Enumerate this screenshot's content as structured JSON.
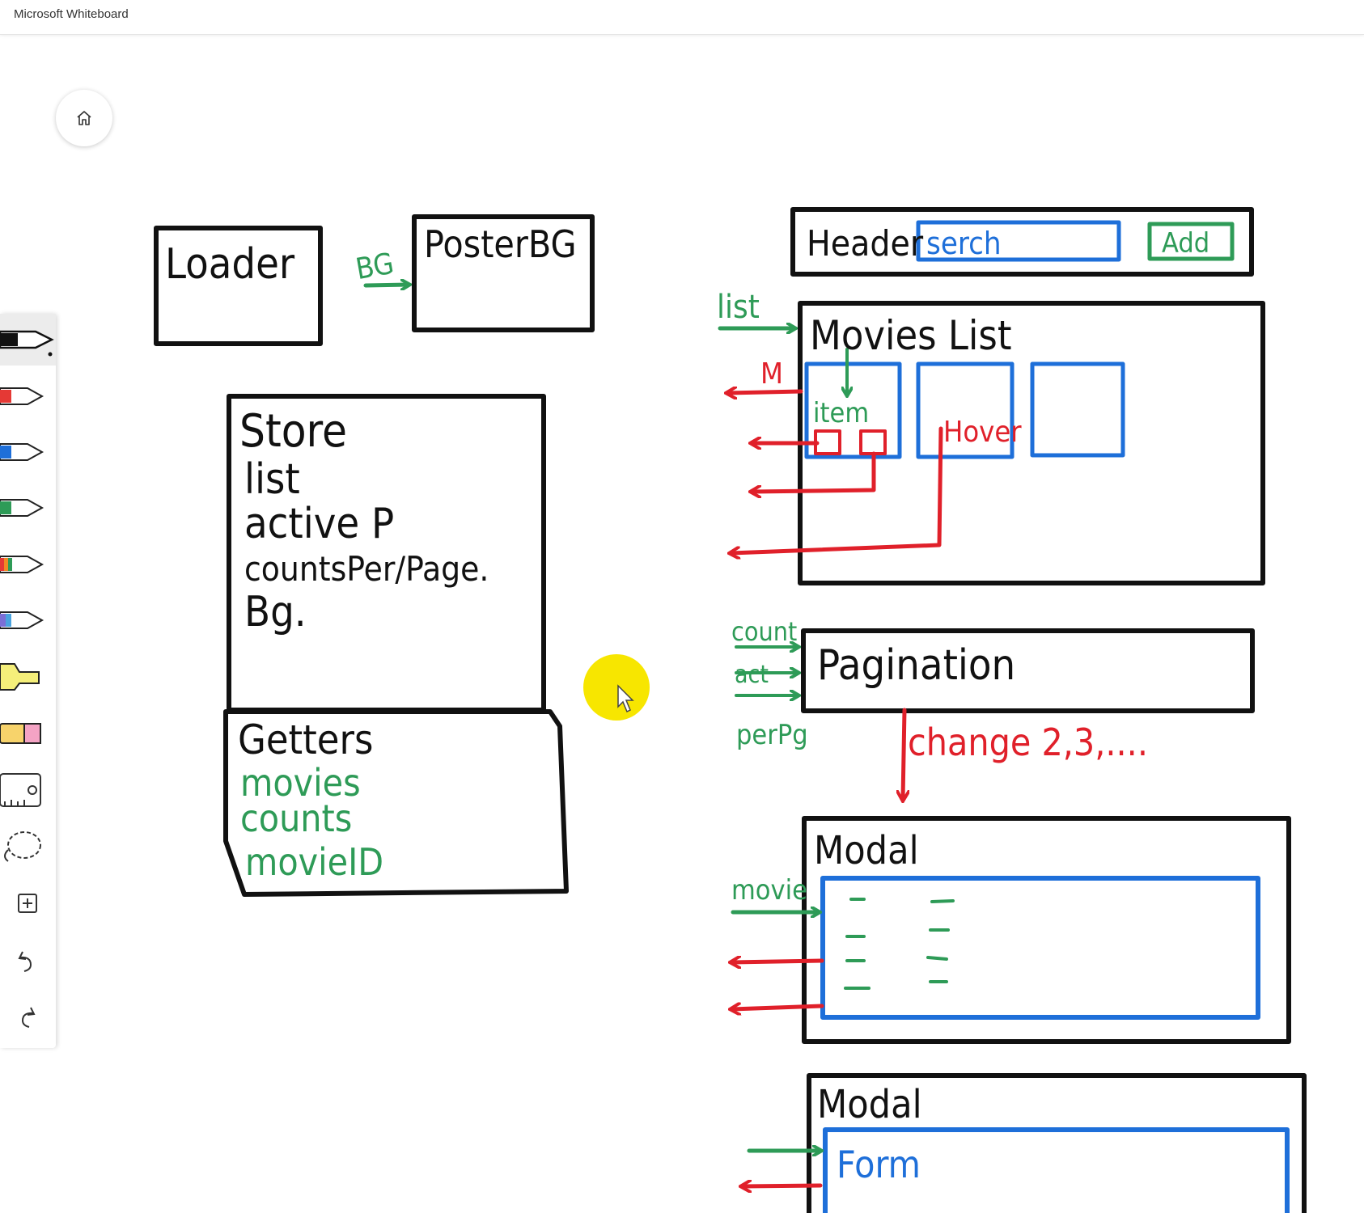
{
  "app": {
    "title": "Microsoft Whiteboard"
  },
  "toolbar": {
    "tools": [
      {
        "name": "pen-black",
        "color": "#111111",
        "selected": true
      },
      {
        "name": "pen-red",
        "color": "#e53935"
      },
      {
        "name": "pen-blue",
        "color": "#1e6fd9"
      },
      {
        "name": "pen-green",
        "color": "#2e9b57"
      },
      {
        "name": "pen-rainbow",
        "color": "#f08a24"
      },
      {
        "name": "pen-galaxy",
        "color": "#7b6fd6"
      },
      {
        "name": "highlighter",
        "color": "#f5ef7a"
      },
      {
        "name": "eraser",
        "color": "#f4a3c4"
      },
      {
        "name": "ruler-icon"
      },
      {
        "name": "lasso-icon"
      },
      {
        "name": "add-icon"
      },
      {
        "name": "undo-icon"
      },
      {
        "name": "redo-icon"
      }
    ]
  },
  "board": {
    "loader": "Loader",
    "bg_arrow": "BG",
    "poster": "PosterBG",
    "store": {
      "title": "Store",
      "lines": [
        "list",
        "active P",
        "countsPer/Page.",
        "Bg."
      ]
    },
    "getters": {
      "title": "Getters",
      "items": [
        "movies",
        "counts",
        "movieID"
      ]
    },
    "header": {
      "title": "Header",
      "search": "serch",
      "add": "Add"
    },
    "list_arrow": "list",
    "movies_list": {
      "title": "Movies List",
      "item": "item",
      "hover": "Hover",
      "m": "M"
    },
    "pagination": {
      "title": "Pagination",
      "inputs": [
        "count",
        "act",
        "perPg"
      ],
      "change": "change 2,3,...."
    },
    "modal1": {
      "title": "Modal",
      "input": "movie"
    },
    "modal2": {
      "title": "Modal",
      "form": "Form"
    }
  },
  "colors": {
    "black": "#111111",
    "green": "#2e9b57",
    "blue": "#1e6fd9",
    "red": "#e0202a",
    "cursor": "#f7e600"
  }
}
